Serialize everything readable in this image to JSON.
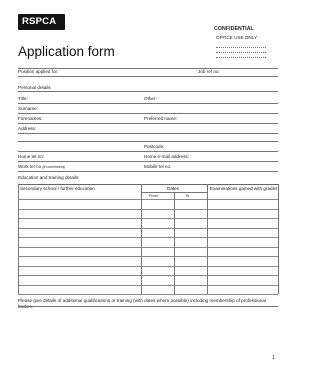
{
  "header": {
    "logo_text": "RSPCA",
    "confidential": "CONFIDENTIAL",
    "office_use": "OFFICE USE ONLY"
  },
  "form": {
    "title": "Application form",
    "position_label": "Position applied for:",
    "job_ref_label": "Job ref no:",
    "personal_details": "Personal details",
    "title_label": "Title:",
    "other_label": "Other:",
    "surname_label": "Surname:",
    "forenames_label": "Forenames:",
    "preferred_label": "Preferred name:",
    "address_label": "Address:",
    "postcode_label": "Postcode:",
    "home_tel_label": "Home tel no:",
    "home_email_label": "Home e-mail address:",
    "work_tel_label": "Work tel no",
    "work_tel_note": "(if convenient)",
    "mobile_label": "Mobile tel no:",
    "education_heading": "Education and training details",
    "table": {
      "col_school": "Secondary school / further education",
      "col_dates": "Dates",
      "col_from": "From",
      "col_to": "To",
      "col_exams": "Examinations gained with grades",
      "row_count": 10
    },
    "additional_text": "Please give details of additional qualifications or training (with dates where possible) including membership of professional bodies."
  },
  "footer": {
    "page_number": "1"
  }
}
